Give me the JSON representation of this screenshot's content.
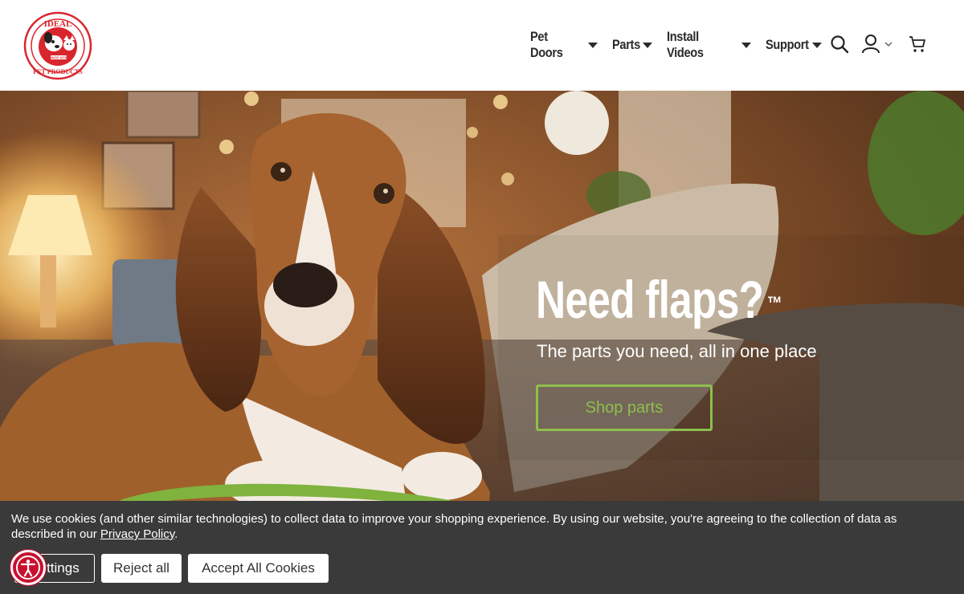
{
  "brand": {
    "logo_top": "IDEAL",
    "logo_bottom": "PET PRODUCTS",
    "logo_since": "SINCE 1978"
  },
  "nav": {
    "items": [
      {
        "label": "Pet Doors"
      },
      {
        "label": "Parts"
      },
      {
        "label": "Install Videos"
      },
      {
        "label": "Support"
      }
    ],
    "icons": [
      "search-icon",
      "user-icon",
      "chevron-down-icon",
      "cart-icon"
    ]
  },
  "hero": {
    "title": "Need flaps?",
    "tm": "™",
    "subtitle": "The parts you need, all in one place",
    "cta": "Shop parts"
  },
  "cookie": {
    "text_before": "We use cookies (and other similar technologies) to collect data to improve your shopping experience. By using our website, you're agreeing to the collection of data as described in our ",
    "link": "Privacy Policy",
    "text_after": ".",
    "settings_label": "Settings",
    "reject_label": "Reject all",
    "accept_label": "Accept All Cookies"
  },
  "colors": {
    "accent_green": "#8fbf4d",
    "brand_red": "#c8102e",
    "banner_bg": "#3a3a3a"
  }
}
